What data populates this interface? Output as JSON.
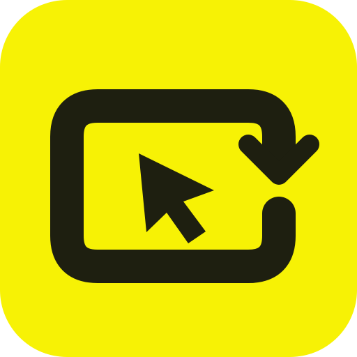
{
  "app_icon": {
    "icon": "cursor-refresh-icon",
    "colors": {
      "background": "#F7F205",
      "glyph": "#1E1F10"
    }
  }
}
